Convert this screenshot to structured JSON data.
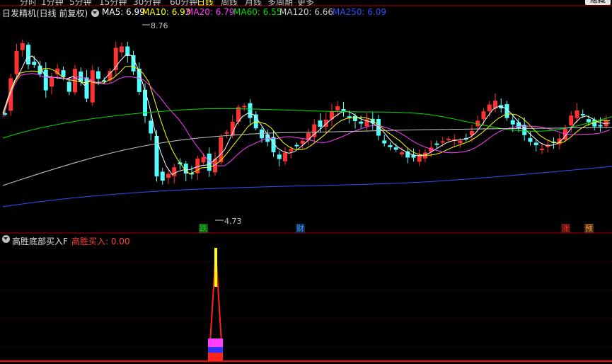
{
  "topbar": {
    "tabs": [
      "分时",
      "1分钟",
      "5分钟",
      "15分钟",
      "30分钟",
      "60分钟",
      "日线",
      "周线",
      "月线",
      "多周期",
      "更多"
    ],
    "active_index": 6,
    "hide_label": "隐藏"
  },
  "info": {
    "indicator_name": "日发精机(日线 前复权)",
    "ma": [
      {
        "label": "MA5: 6.99",
        "color": "#ffffff"
      },
      {
        "label": "MA10: 6.93",
        "color": "#ffff00"
      },
      {
        "label": "MA20: 6.79",
        "color": "#ff40ff"
      },
      {
        "label": "MA60: 6.55",
        "color": "#00e000"
      },
      {
        "label": "MA120: 6.66",
        "color": "#c8c8c8"
      },
      {
        "label": "MA250: 6.09",
        "color": "#3050ff"
      }
    ]
  },
  "price": {
    "high_label": "8.76",
    "low_label": "4.73"
  },
  "badges": [
    {
      "text": "跌",
      "color": "#00e000",
      "bg": "#1e4d1e"
    },
    {
      "text": "财",
      "color": "#40a0ff",
      "bg": "#0e2a4d"
    },
    {
      "text": "涨",
      "color": "#ff3030",
      "bg": "#4d1010"
    },
    {
      "text": "预",
      "color": "#ffa040",
      "bg": "#4d2a0e"
    }
  ],
  "indicator": {
    "name": "高胜底部买入F",
    "value_label": "高胜买入: 0.00"
  },
  "colors": {
    "up": "#ff3232",
    "down": "#54ffff",
    "ma5": "#ffffff",
    "ma10": "#ffff00",
    "ma20": "#ff40ff",
    "ma60": "#00e000",
    "ma120": "#c8c8c8",
    "ma250": "#3050ff",
    "divider": "#b00000"
  }
}
